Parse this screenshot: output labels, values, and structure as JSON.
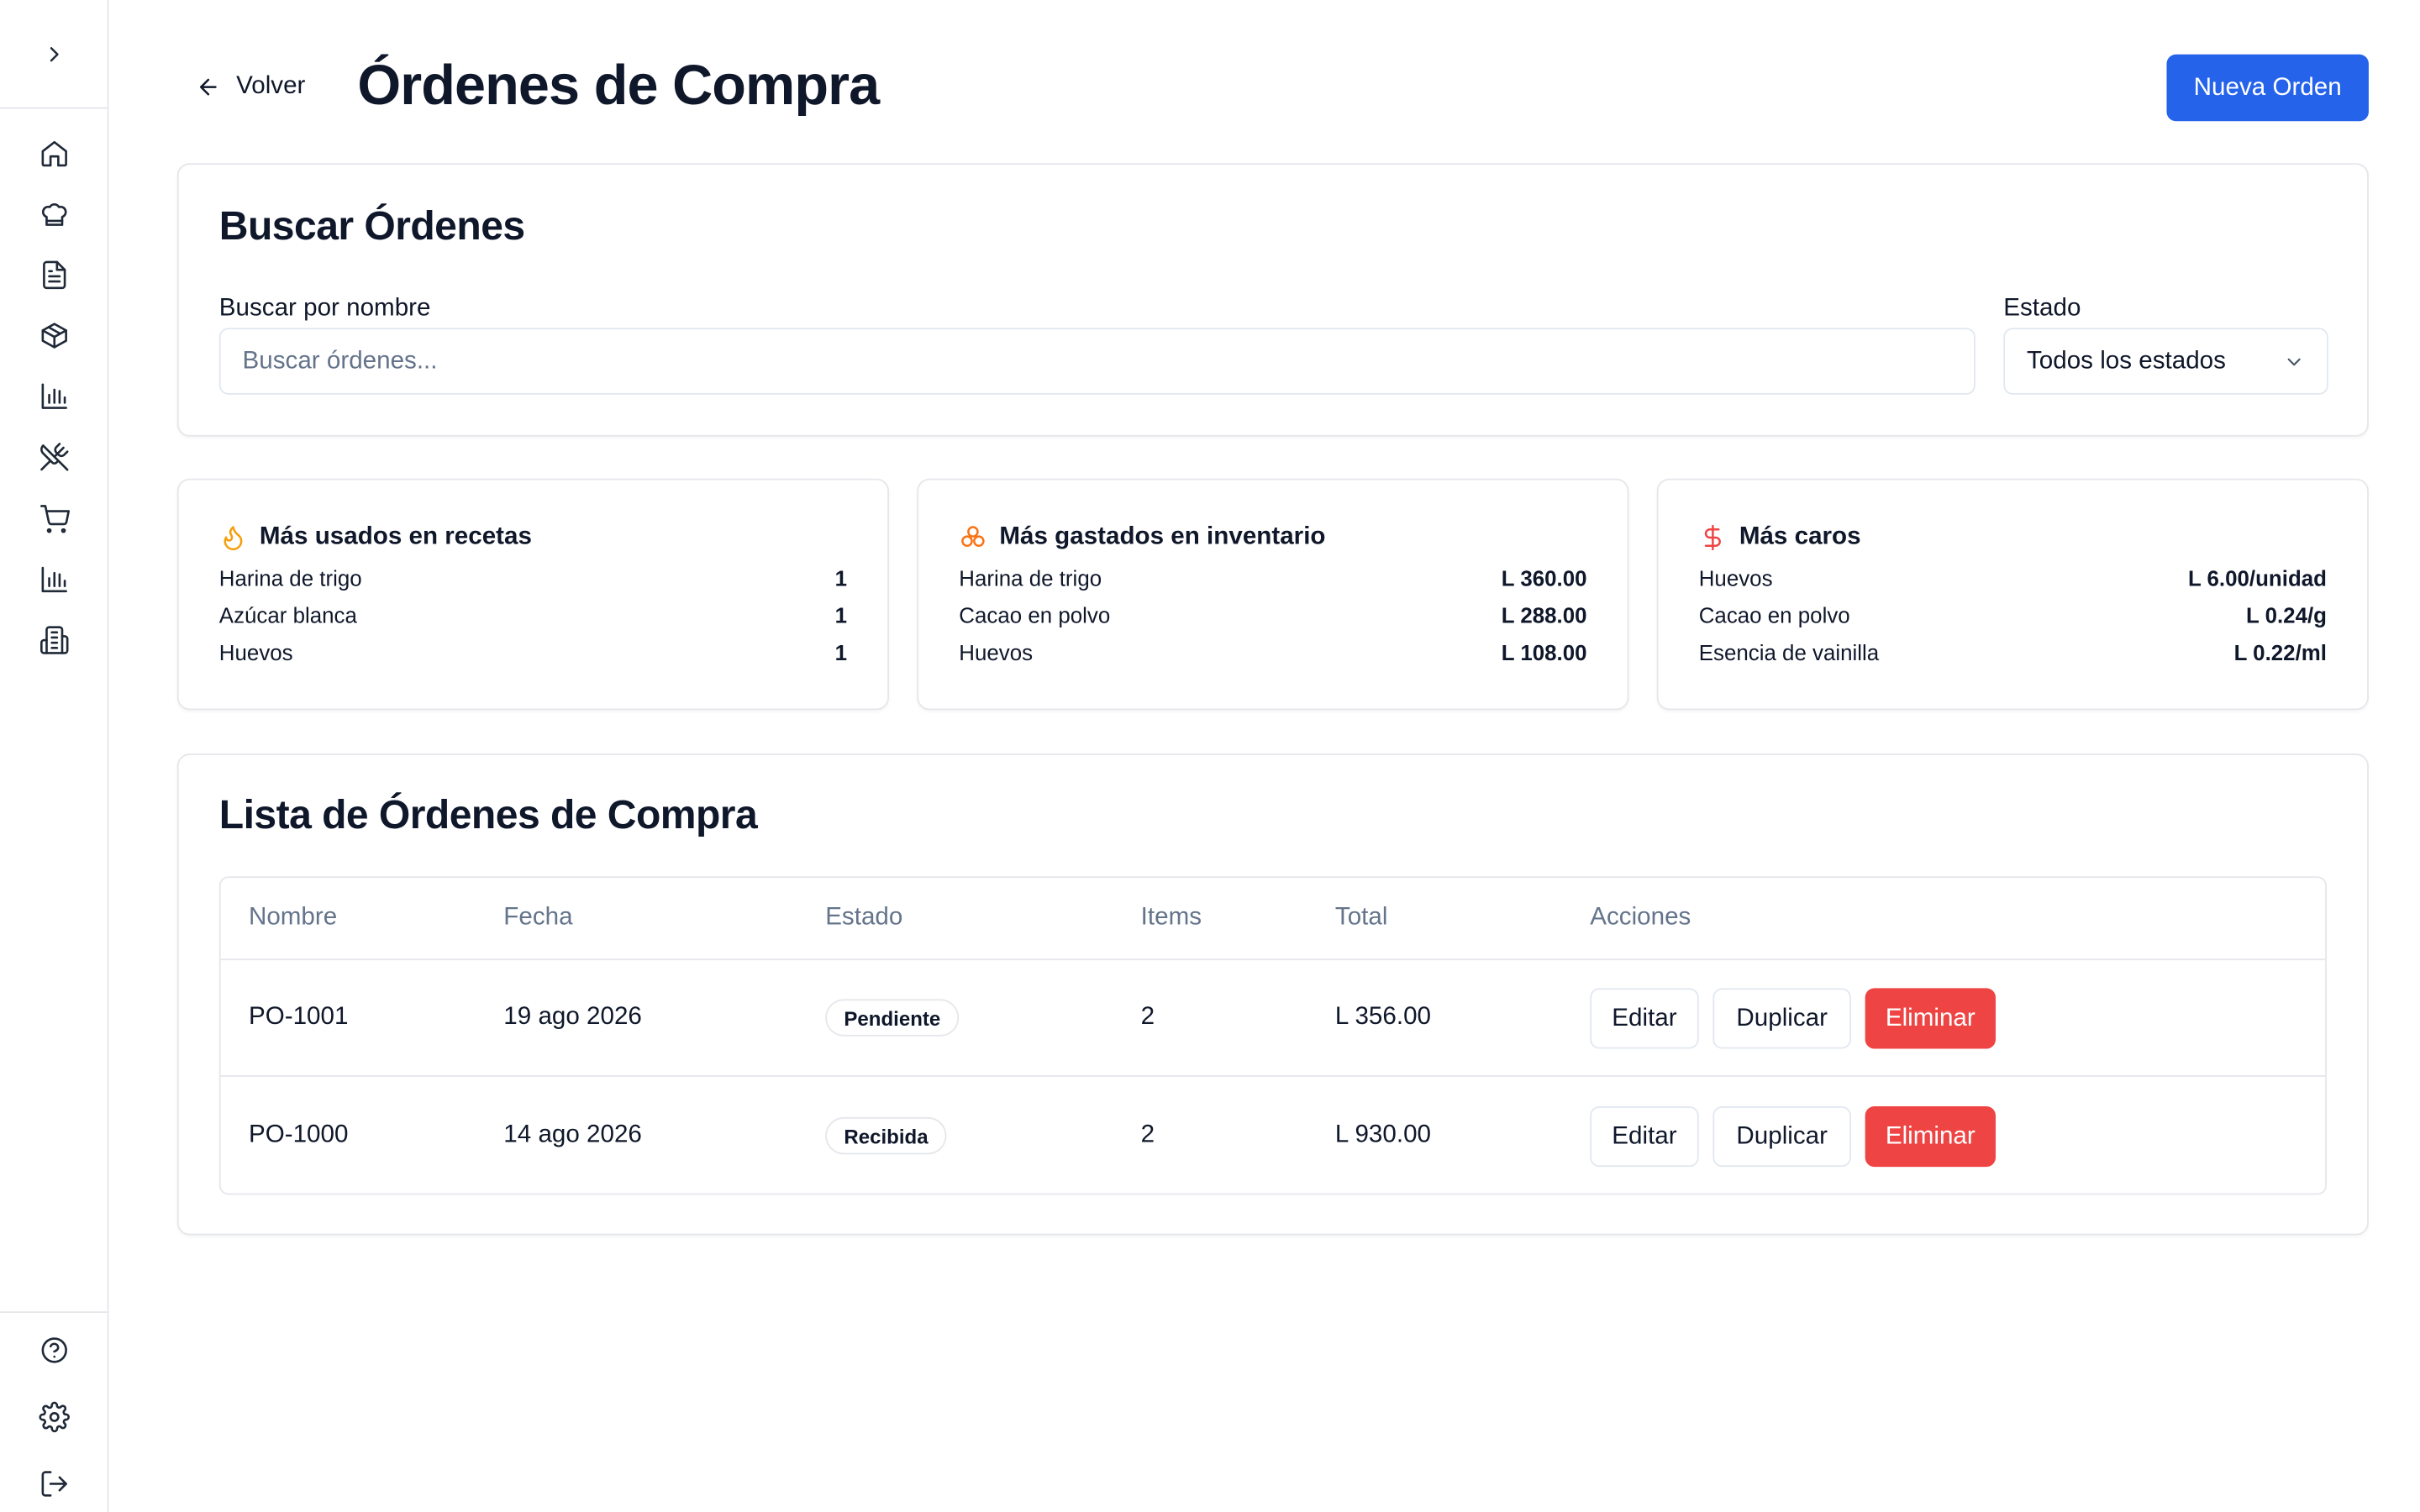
{
  "header": {
    "back_label": "Volver",
    "title": "Órdenes de Compra",
    "new_order_label": "Nueva Orden"
  },
  "sidebar": {
    "items": [
      {
        "icon": "home-icon"
      },
      {
        "icon": "chef-hat-icon"
      },
      {
        "icon": "document-icon"
      },
      {
        "icon": "package-icon"
      },
      {
        "icon": "bar-chart-icon"
      },
      {
        "icon": "utensils-crossed-icon"
      },
      {
        "icon": "shopping-cart-icon"
      },
      {
        "icon": "bar-chart-icon"
      },
      {
        "icon": "building-icon"
      }
    ],
    "bottom": [
      {
        "icon": "help-icon"
      },
      {
        "icon": "gear-icon"
      },
      {
        "icon": "logout-icon"
      }
    ]
  },
  "search": {
    "title": "Buscar Órdenes",
    "name_label": "Buscar por nombre",
    "name_placeholder": "Buscar órdenes...",
    "status_label": "Estado",
    "status_value": "Todos los estados"
  },
  "stats": [
    {
      "title": "Más usados en recetas",
      "icon": "flame-icon",
      "icon_color": "#f59e0b",
      "rows": [
        {
          "name": "Harina de trigo",
          "value": "1"
        },
        {
          "name": "Azúcar blanca",
          "value": "1"
        },
        {
          "name": "Huevos",
          "value": "1"
        }
      ]
    },
    {
      "title": "Más gastados en inventario",
      "icon": "coins-icon",
      "icon_color": "#f97316",
      "rows": [
        {
          "name": "Harina de trigo",
          "value": "L 360.00"
        },
        {
          "name": "Cacao en polvo",
          "value": "L 288.00"
        },
        {
          "name": "Huevos",
          "value": "L 108.00"
        }
      ]
    },
    {
      "title": "Más caros",
      "icon": "dollar-icon",
      "icon_color": "#ef4444",
      "rows": [
        {
          "name": "Huevos",
          "value": "L 6.00/unidad"
        },
        {
          "name": "Cacao en polvo",
          "value": "L 0.24/g"
        },
        {
          "name": "Esencia de vainilla",
          "value": "L 0.22/ml"
        }
      ]
    }
  ],
  "orders": {
    "title": "Lista de Órdenes de Compra",
    "columns": [
      "Nombre",
      "Fecha",
      "Estado",
      "Items",
      "Total",
      "Acciones"
    ],
    "rows": [
      {
        "name": "PO-1001",
        "date": "19 ago 2026",
        "status": "Pendiente",
        "items": "2",
        "total": "L 356.00"
      },
      {
        "name": "PO-1000",
        "date": "14 ago 2026",
        "status": "Recibida",
        "items": "2",
        "total": "L 930.00"
      }
    ],
    "actions": {
      "edit": "Editar",
      "duplicate": "Duplicar",
      "delete": "Eliminar"
    }
  },
  "colors": {
    "primary": "#2563eb",
    "danger": "#ef4444"
  }
}
